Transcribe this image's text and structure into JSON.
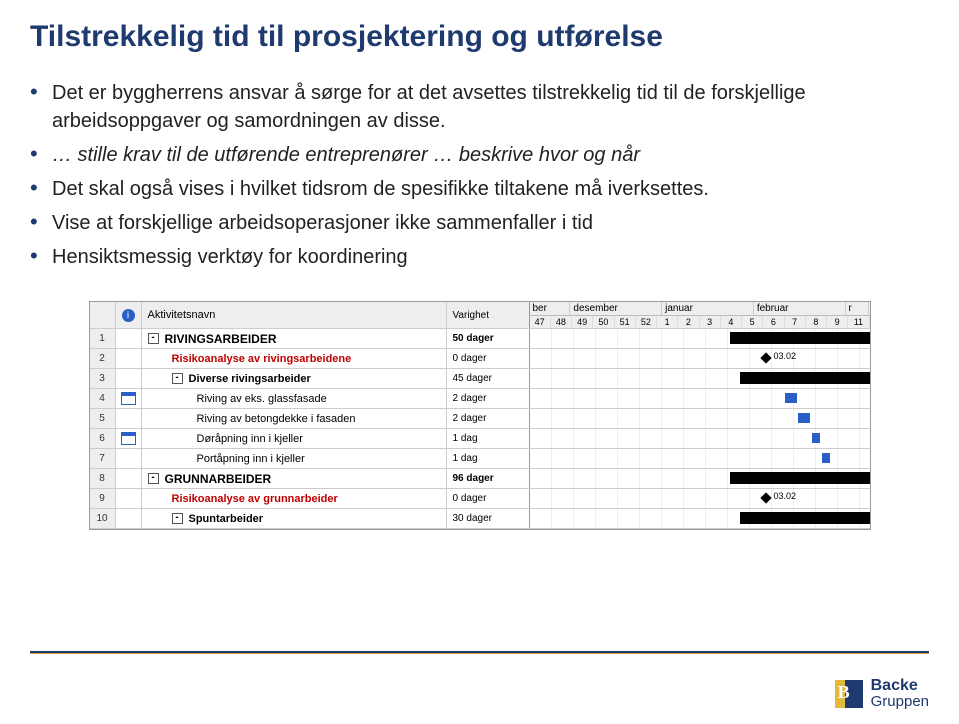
{
  "title": "Tilstrekkelig tid til prosjektering og utførelse",
  "bullets": {
    "b1": "Det er byggherrens ansvar å sørge for at det avsettes tilstrekkelig tid til de forskjellige arbeidsoppgaver og samordningen av disse.",
    "b2a": "… stille krav til de utførende entreprenører … beskrive hvor og når",
    "b3": "Det skal også vises i hvilket tidsrom de spesifikke tiltakene må iverksettes.",
    "b4": "Vise at forskjellige arbeidsoperasjoner ikke sammenfaller i tid",
    "b5": "Hensiktsmessig verktøy for koordinering"
  },
  "gantt": {
    "col_name": "Aktivitetsnavn",
    "col_dur": "Varighet",
    "info_icon": "i",
    "months": [
      "ber",
      "desember",
      "januar",
      "februar",
      "r"
    ],
    "weeks": [
      "47",
      "48",
      "49",
      "50",
      "51",
      "52",
      "1",
      "2",
      "3",
      "4",
      "5",
      "6",
      "7",
      "8",
      "9",
      "11"
    ],
    "rows": [
      {
        "n": "1",
        "name": "RIVINGSARBEIDER",
        "dur": "50 dager",
        "kind": "section"
      },
      {
        "n": "2",
        "name": "Risikoanalyse av rivingsarbeidene",
        "dur": "0 dager",
        "kind": "risk",
        "date": "03.02"
      },
      {
        "n": "3",
        "name": "Diverse rivingsarbeider",
        "dur": "45 dager",
        "kind": "subsection"
      },
      {
        "n": "4",
        "name": "Riving av eks. glassfasade",
        "dur": "2 dager",
        "kind": "task",
        "cal": true
      },
      {
        "n": "5",
        "name": "Riving av betongdekke i fasaden",
        "dur": "2 dager",
        "kind": "task"
      },
      {
        "n": "6",
        "name": "Døråpning inn i kjeller",
        "dur": "1 dag",
        "kind": "task",
        "cal": true
      },
      {
        "n": "7",
        "name": "Portåpning inn i kjeller",
        "dur": "1 dag",
        "kind": "task"
      },
      {
        "n": "8",
        "name": "GRUNNARBEIDER",
        "dur": "96 dager",
        "kind": "section"
      },
      {
        "n": "9",
        "name": "Risikoanalyse av grunnarbeider",
        "dur": "0 dager",
        "kind": "risk",
        "date": "03.02"
      },
      {
        "n": "10",
        "name": "Spuntarbeider",
        "dur": "30 dager",
        "kind": "subsection"
      }
    ]
  },
  "logo": {
    "letter": "B",
    "line1": "Backe",
    "line2": "Gruppen",
    "dash": "–"
  }
}
